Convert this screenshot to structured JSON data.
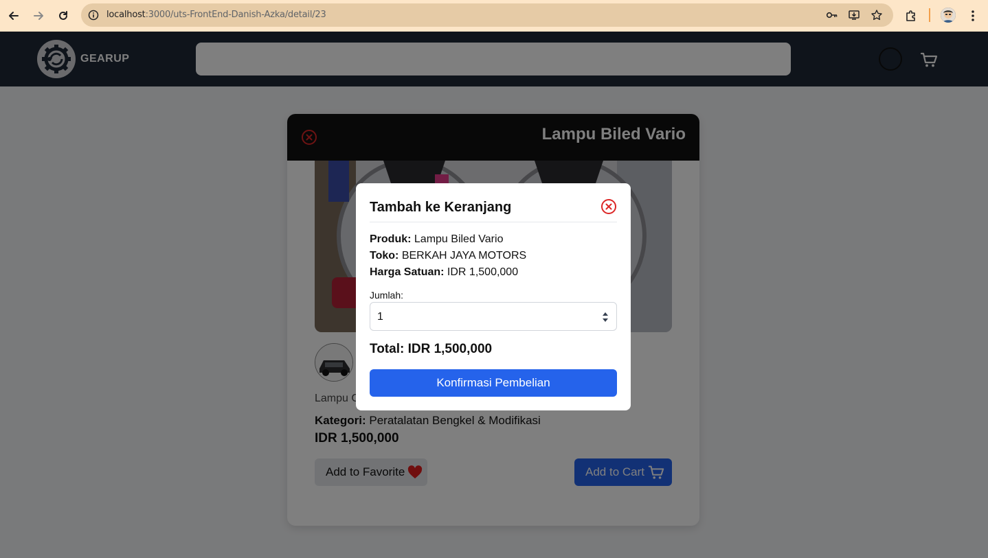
{
  "browser": {
    "url_host": "localhost",
    "url_path": ":3000/uts-FrontEnd-Danish-Azka/detail/23"
  },
  "header": {
    "brand": "GEARUP",
    "search_placeholder": ""
  },
  "product": {
    "title": "Lampu Biled Vario",
    "description_visible": "Lampu G",
    "category_label": "Kategori:",
    "category_value": "Peratalatan Bengkel & Modifikasi",
    "price": "IDR 1,500,000",
    "favorite_label": "Add to Favorite",
    "cart_label": "Add to Cart"
  },
  "modal": {
    "title": "Tambah ke Keranjang",
    "product_label": "Produk:",
    "product_value": "Lampu Biled Vario",
    "store_label": "Toko:",
    "store_value": "BERKAH JAYA MOTORS",
    "unit_price_label": "Harga Satuan:",
    "unit_price_value": "IDR 1,500,000",
    "qty_label": "Jumlah:",
    "qty_value": "1",
    "total": "Total: IDR 1,500,000",
    "confirm_label": "Konfirmasi Pembelian"
  },
  "colors": {
    "chrome_bg": "#fde6c8",
    "header_bg": "#1f2937",
    "accent_blue": "#2563eb",
    "close_red": "#dc2626",
    "heart_red": "#e11d1d"
  },
  "icons": [
    "back-icon",
    "forward-icon",
    "reload-icon",
    "info-icon",
    "key-icon",
    "install-icon",
    "star-icon",
    "extensions-icon",
    "profile-icon",
    "menu-icon",
    "logo-gear-icon",
    "cart-icon",
    "close-circle-icon",
    "heart-icon"
  ]
}
